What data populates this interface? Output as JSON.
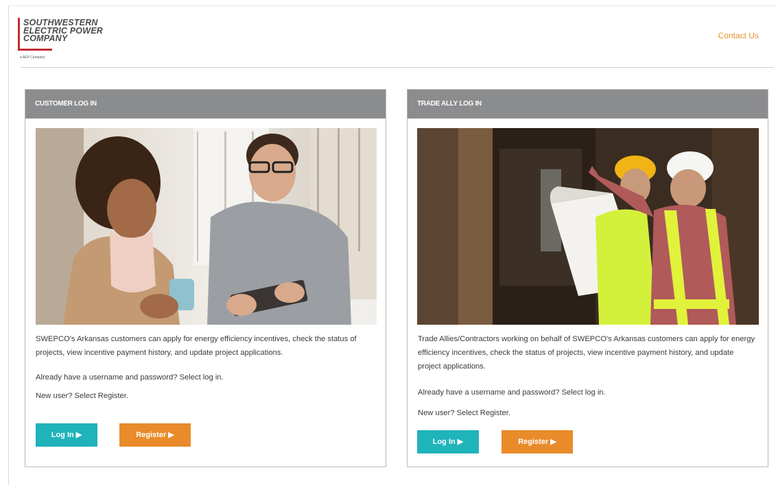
{
  "header": {
    "logo_text": "SOUTHWESTERN\nELECTRIC POWER\nCOMPANY",
    "logo_tagline": "a AEP Company",
    "contact_label": "Contact Us"
  },
  "colors": {
    "panel_header": "#8b8c8e",
    "login": "#1fb3ba",
    "register": "#e98b2a",
    "brand_red": "#c62b33",
    "link": "#e6922a"
  },
  "customer": {
    "heading": "CUSTOMER LOG IN",
    "description": "SWEPCO's Arkansas customers can apply for energy efficiency incentives, check the status of projects, view incentive payment history, and update project applications.",
    "existing": "Already have a username and password? Select log in.",
    "new_user": "New user? Select Register.",
    "login_label": "Log In ▶",
    "register_label": "Register ▶"
  },
  "trade_ally": {
    "heading": "TRADE ALLY LOG IN",
    "description": "Trade Allies/Contractors working on behalf of SWEPCO's Arkansas customers can apply for energy efficiency incentives, check the status of projects, view incentive payment history, and update project applications.",
    "existing": "Already have a username and password? Select log in.",
    "new_user": "New user? Select Register.",
    "login_label": "Log In ▶",
    "register_label": "Register ▶"
  }
}
